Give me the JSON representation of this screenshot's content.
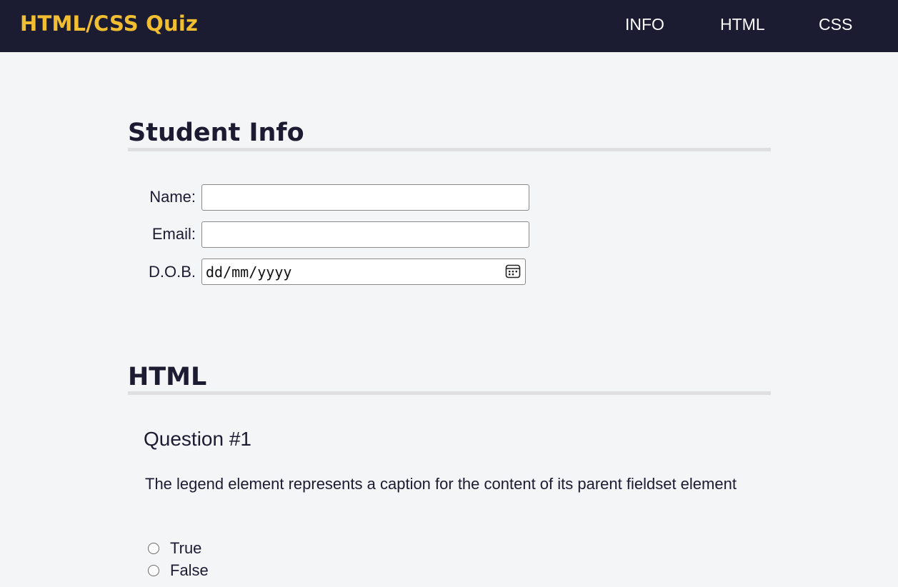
{
  "header": {
    "brand": "HTML/CSS Quiz",
    "nav": [
      {
        "label": "INFO"
      },
      {
        "label": "HTML"
      },
      {
        "label": "CSS"
      }
    ]
  },
  "student_info": {
    "title": "Student Info",
    "fields": {
      "name": {
        "label": "Name:",
        "value": ""
      },
      "email": {
        "label": "Email:",
        "value": ""
      },
      "dob": {
        "label": "D.O.B.",
        "placeholder": "dd/mm/yyyy",
        "icon": "calendar-icon"
      }
    }
  },
  "html_section": {
    "title": "HTML",
    "questions": [
      {
        "heading": "Question #1",
        "text": "The legend element represents a caption for the content of its parent fieldset element",
        "options": [
          {
            "label": "True",
            "selected": false
          },
          {
            "label": "False",
            "selected": false
          }
        ]
      }
    ]
  },
  "colors": {
    "header_bg": "#1b1b32",
    "brand": "#f1be32",
    "page_bg": "#f4f5f7",
    "rule": "#dfdfe2"
  }
}
